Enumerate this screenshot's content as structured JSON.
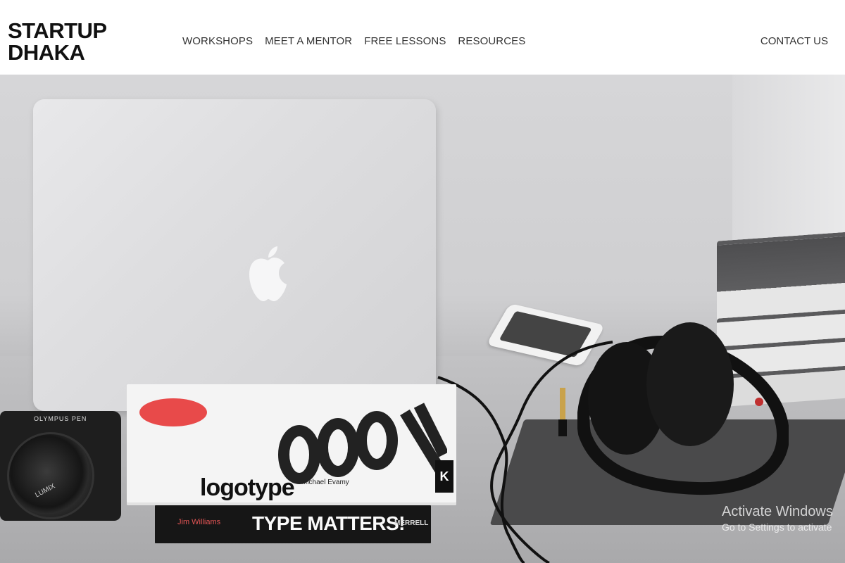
{
  "brand": {
    "line1": "STARTUP",
    "line2": "DHAKA"
  },
  "nav": [
    {
      "label": "WORKSHOPS"
    },
    {
      "label": "MEET A MENTOR"
    },
    {
      "label": "FREE LESSONS"
    },
    {
      "label": "RESOURCES"
    }
  ],
  "contact": {
    "label": "CONTACT US"
  },
  "hero": {
    "camera_brand": "OLYMPUS PEN",
    "lens_brand": "LUMIX",
    "book1": {
      "title": "logotype",
      "author": "Michael Evamy",
      "badge": "K"
    },
    "book2": {
      "author": "Jim Williams",
      "title": "TYPE MATTERS!",
      "publisher": "MERRELL"
    }
  },
  "watermark": {
    "title": "Activate Windows",
    "subtitle": "Go to Settings to activate"
  },
  "colors": {
    "text": "#333333",
    "logo": "#111111",
    "accent_red": "#e84a4a"
  }
}
